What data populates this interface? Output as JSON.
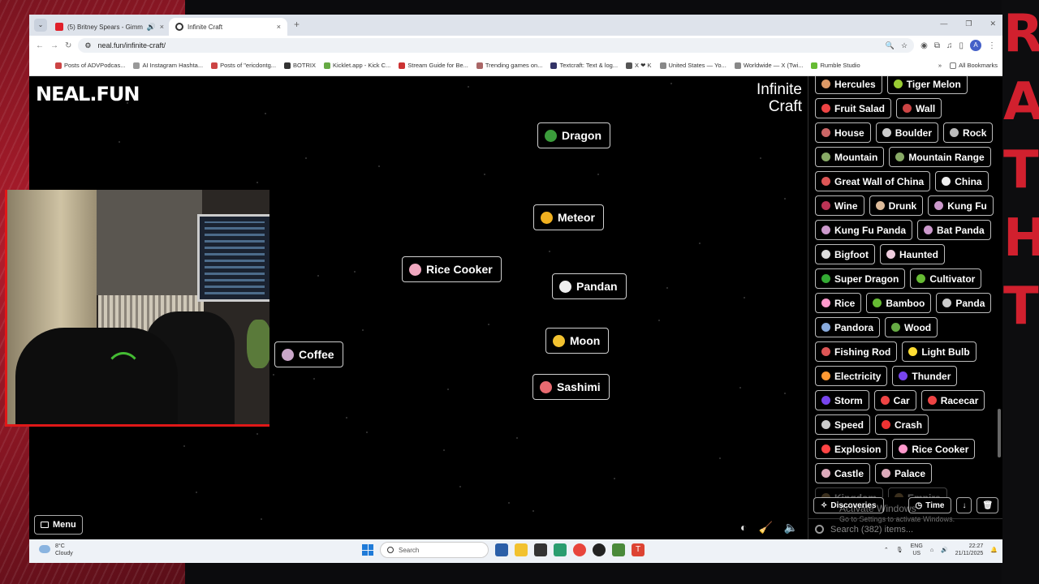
{
  "overlay": {
    "side_text": "RATHT"
  },
  "browser": {
    "tabs": [
      {
        "title": "(5) Britney Spears - Gimme",
        "favicon_color": "#e0202a",
        "close": "×"
      },
      {
        "title": "Infinite Craft",
        "favicon_color": "#333333",
        "close": "×"
      }
    ],
    "new_tab": "+",
    "url": "neal.fun/infinite-craft/",
    "avatar": "A",
    "bookmarks": [
      {
        "label": "Posts of ADVPodcas...",
        "color": "#c44"
      },
      {
        "label": "AI Instagram Hashta...",
        "color": "#999"
      },
      {
        "label": "Posts of \"ericdontg...",
        "color": "#c44"
      },
      {
        "label": "BOTRIX",
        "color": "#333"
      },
      {
        "label": "Kicklet.app - Kick C...",
        "color": "#6a4"
      },
      {
        "label": "Stream Guide for Be...",
        "color": "#c33"
      },
      {
        "label": "Trending games on...",
        "color": "#a66"
      },
      {
        "label": "Textcraft: Text & log...",
        "color": "#336"
      },
      {
        "label": "X ❤ K",
        "color": "#555"
      },
      {
        "label": "United States — Yo...",
        "color": "#888"
      },
      {
        "label": "Worldwide — X (Twi...",
        "color": "#888"
      },
      {
        "label": "Rumble Studio",
        "color": "#6b3"
      }
    ],
    "all_bookmarks": "All Bookmarks"
  },
  "game": {
    "logo": "NEAL.FUN",
    "brand_line1": "Infinite",
    "brand_line2": "Craft",
    "canvas_items": [
      {
        "label": "Dragon",
        "emoji": "dragon-emoji",
        "color": "#3b9c3b"
      },
      {
        "label": "Meteor",
        "emoji": "comet-emoji",
        "color": "#f0b020"
      },
      {
        "label": "Rice Cooker",
        "emoji": "rice-cooker-emoji",
        "color": "#f0a8c0"
      },
      {
        "label": "Pandan",
        "emoji": "leaf-cup-emoji",
        "color": "#eeeeee"
      },
      {
        "label": "Coffee",
        "emoji": "coffee-emoji",
        "color": "#c9a6c8"
      },
      {
        "label": "Moon",
        "emoji": "crescent-moon-emoji",
        "color": "#f2c230"
      },
      {
        "label": "Sashimi",
        "emoji": "sashimi-emoji",
        "color": "#e86a70"
      }
    ],
    "menu_label": "Menu"
  },
  "sidebar": {
    "items": [
      {
        "label": "Hercules",
        "color": "#d96"
      },
      {
        "label": "Tiger Melon",
        "color": "#9c3"
      },
      {
        "label": "Fruit Salad",
        "color": "#e44"
      },
      {
        "label": "Wall",
        "color": "#c44"
      },
      {
        "label": "House",
        "color": "#c66"
      },
      {
        "label": "Boulder",
        "color": "#ccc"
      },
      {
        "label": "Rock",
        "color": "#bbb"
      },
      {
        "label": "Mountain",
        "color": "#8a6"
      },
      {
        "label": "Mountain Range",
        "color": "#8a6"
      },
      {
        "label": "Great Wall of China",
        "color": "#d55"
      },
      {
        "label": "China",
        "color": "#eee"
      },
      {
        "label": "Wine",
        "color": "#b35"
      },
      {
        "label": "Drunk",
        "color": "#db9"
      },
      {
        "label": "Kung Fu",
        "color": "#c9c"
      },
      {
        "label": "Kung Fu Panda",
        "color": "#c9c"
      },
      {
        "label": "Bat Panda",
        "color": "#c9c"
      },
      {
        "label": "Bigfoot",
        "color": "#ddd"
      },
      {
        "label": "Haunted",
        "color": "#ecd"
      },
      {
        "label": "Super Dragon",
        "color": "#3a3"
      },
      {
        "label": "Cultivator",
        "color": "#6b3"
      },
      {
        "label": "Rice",
        "color": "#f9c"
      },
      {
        "label": "Bamboo",
        "color": "#6b3"
      },
      {
        "label": "Panda",
        "color": "#ccc"
      },
      {
        "label": "Pandora",
        "color": "#8ad"
      },
      {
        "label": "Wood",
        "color": "#6a4"
      },
      {
        "label": "Fishing Rod",
        "color": "#d55"
      },
      {
        "label": "Light Bulb",
        "color": "#fd3"
      },
      {
        "label": "Electricity",
        "color": "#f93"
      },
      {
        "label": "Thunder",
        "color": "#74e"
      },
      {
        "label": "Storm",
        "color": "#74e"
      },
      {
        "label": "Car",
        "color": "#e44"
      },
      {
        "label": "Racecar",
        "color": "#e44"
      },
      {
        "label": "Speed",
        "color": "#ccc"
      },
      {
        "label": "Crash",
        "color": "#e33"
      },
      {
        "label": "Explosion",
        "color": "#f44"
      },
      {
        "label": "Rice Cooker",
        "color": "#f9c"
      },
      {
        "label": "Castle",
        "color": "#dab"
      },
      {
        "label": "Palace",
        "color": "#dab"
      }
    ],
    "faded_items": [
      {
        "label": "Kingdom",
        "color": "#a85"
      },
      {
        "label": "Empire",
        "color": "#a85"
      },
      {
        "label": "War",
        "color": "#c33"
      }
    ],
    "discoveries_label": "Discoveries",
    "time_label": "Time",
    "sort_icon": "↓",
    "delete_icon": "🗑",
    "search_placeholder": "Search (382) items...",
    "activate_title": "Activate Windows",
    "activate_sub": "Go to Settings to activate Windows."
  },
  "taskbar": {
    "temp": "8°C",
    "condition": "Cloudy",
    "search_placeholder": "Search",
    "lang": "ENG",
    "region": "US",
    "time": "22:27",
    "date": "21/11/2025"
  }
}
